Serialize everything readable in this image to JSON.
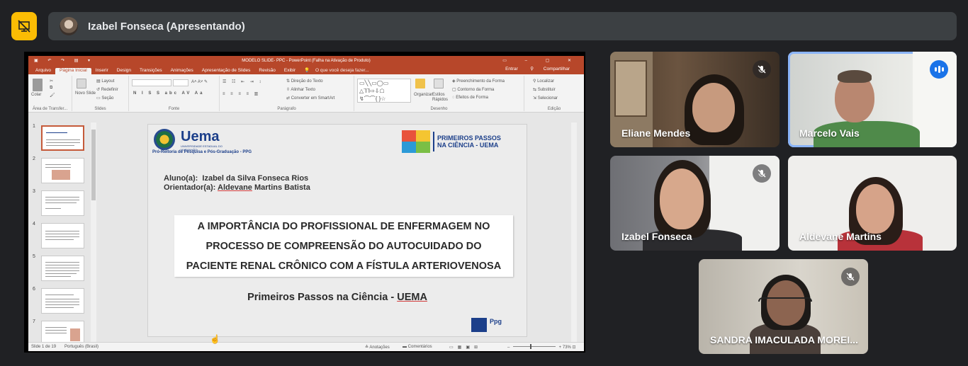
{
  "presenter_bar": {
    "name": "Izabel Fonseca (Apresentando)",
    "stop_presenting_icon": "presentation-off-icon",
    "accent": "#fbbc04"
  },
  "powerpoint": {
    "window_title": "MODELO SLIDE- PPC - PowerPoint (Falha na Ativação de Produto)",
    "tabs": [
      "Arquivo",
      "Página Inicial",
      "Inserir",
      "Design",
      "Transições",
      "Animações",
      "Apresentação de Slides",
      "Revisão",
      "Exibir"
    ],
    "active_tab": "Página Inicial",
    "tell_me": "O que você deseja fazer...",
    "sign_in": "Entrar",
    "share": "Compartilhar",
    "ribbon": {
      "paste": "Colar",
      "new_slide": "Novo Slide",
      "layout": "Layout",
      "reset": "Redefinir",
      "section": "Seção",
      "text_direction": "Direção do Texto",
      "align_text": "Alinhar Texto",
      "smartart": "Converter em SmartArt",
      "arrange": "Organizar",
      "quick_styles": "Estilos Rápidos",
      "shape_fill": "Preenchimento da Forma",
      "shape_outline": "Contorno da Forma",
      "shape_effects": "Efeitos de Forma",
      "find": "Localizar",
      "replace": "Substituir",
      "select": "Selecionar",
      "groups": [
        "Área de Transfer...",
        "Slides",
        "Fonte",
        "Parágrafo",
        "Desenho",
        "Edição"
      ]
    },
    "thumbnails": [
      "1",
      "2",
      "3",
      "4",
      "5",
      "6",
      "7"
    ],
    "status": {
      "slide_count": "Slide 1 de 19",
      "language": "Português (Brasil)",
      "notes": "Anotações",
      "comments": "Comentários",
      "zoom": "73%"
    },
    "slide": {
      "uema_word": "Uema",
      "uema_sub": "UNIVERSIDADE ESTADUAL DO MARANHÃO",
      "proreitoria": "Pró-Reitoria de Pesquisa e Pós-Graduação - PPG",
      "pp_logo_line1": "PRIMEIROS PASSOS",
      "pp_logo_line2": "NA CIÊNCIA - UEMA",
      "aluno_label": "Aluno(a):",
      "aluno_name": "Izabel da Silva Fonseca Rios",
      "orientador_label": "Orientador(a):",
      "orientador_first": "Aldevane",
      "orientador_rest": "Martins Batista",
      "title_line1": "A IMPORTÂNCIA DO PROFISSIONAL DE ENFERMAGEM NO",
      "title_line2": "PROCESSO DE COMPREENSÃO DO AUTOCUIDADO DO",
      "title_line3": "PACIENTE RENAL CRÔNICO COM A FÍSTULA ARTERIOVENOSA",
      "subtitle_prefix": "Primeiros Passos na Ciência - ",
      "subtitle_uema": "UEMA",
      "ppg_text": "Ppg"
    }
  },
  "participants": [
    {
      "name": "Eliane Mendes",
      "muted": true
    },
    {
      "name": "Marcelo Vais",
      "speaking": true
    },
    {
      "name": "Izabel Fonseca",
      "muted": true
    },
    {
      "name": "Aldevane Martins"
    },
    {
      "name": "SANDRA IMACULADA MOREI...",
      "muted": true
    }
  ],
  "colors": {
    "ppt_brand": "#b7472a",
    "meet_bg": "#202124",
    "speaking_blue": "#1a73e8",
    "uema_blue": "#1c3f8a"
  }
}
